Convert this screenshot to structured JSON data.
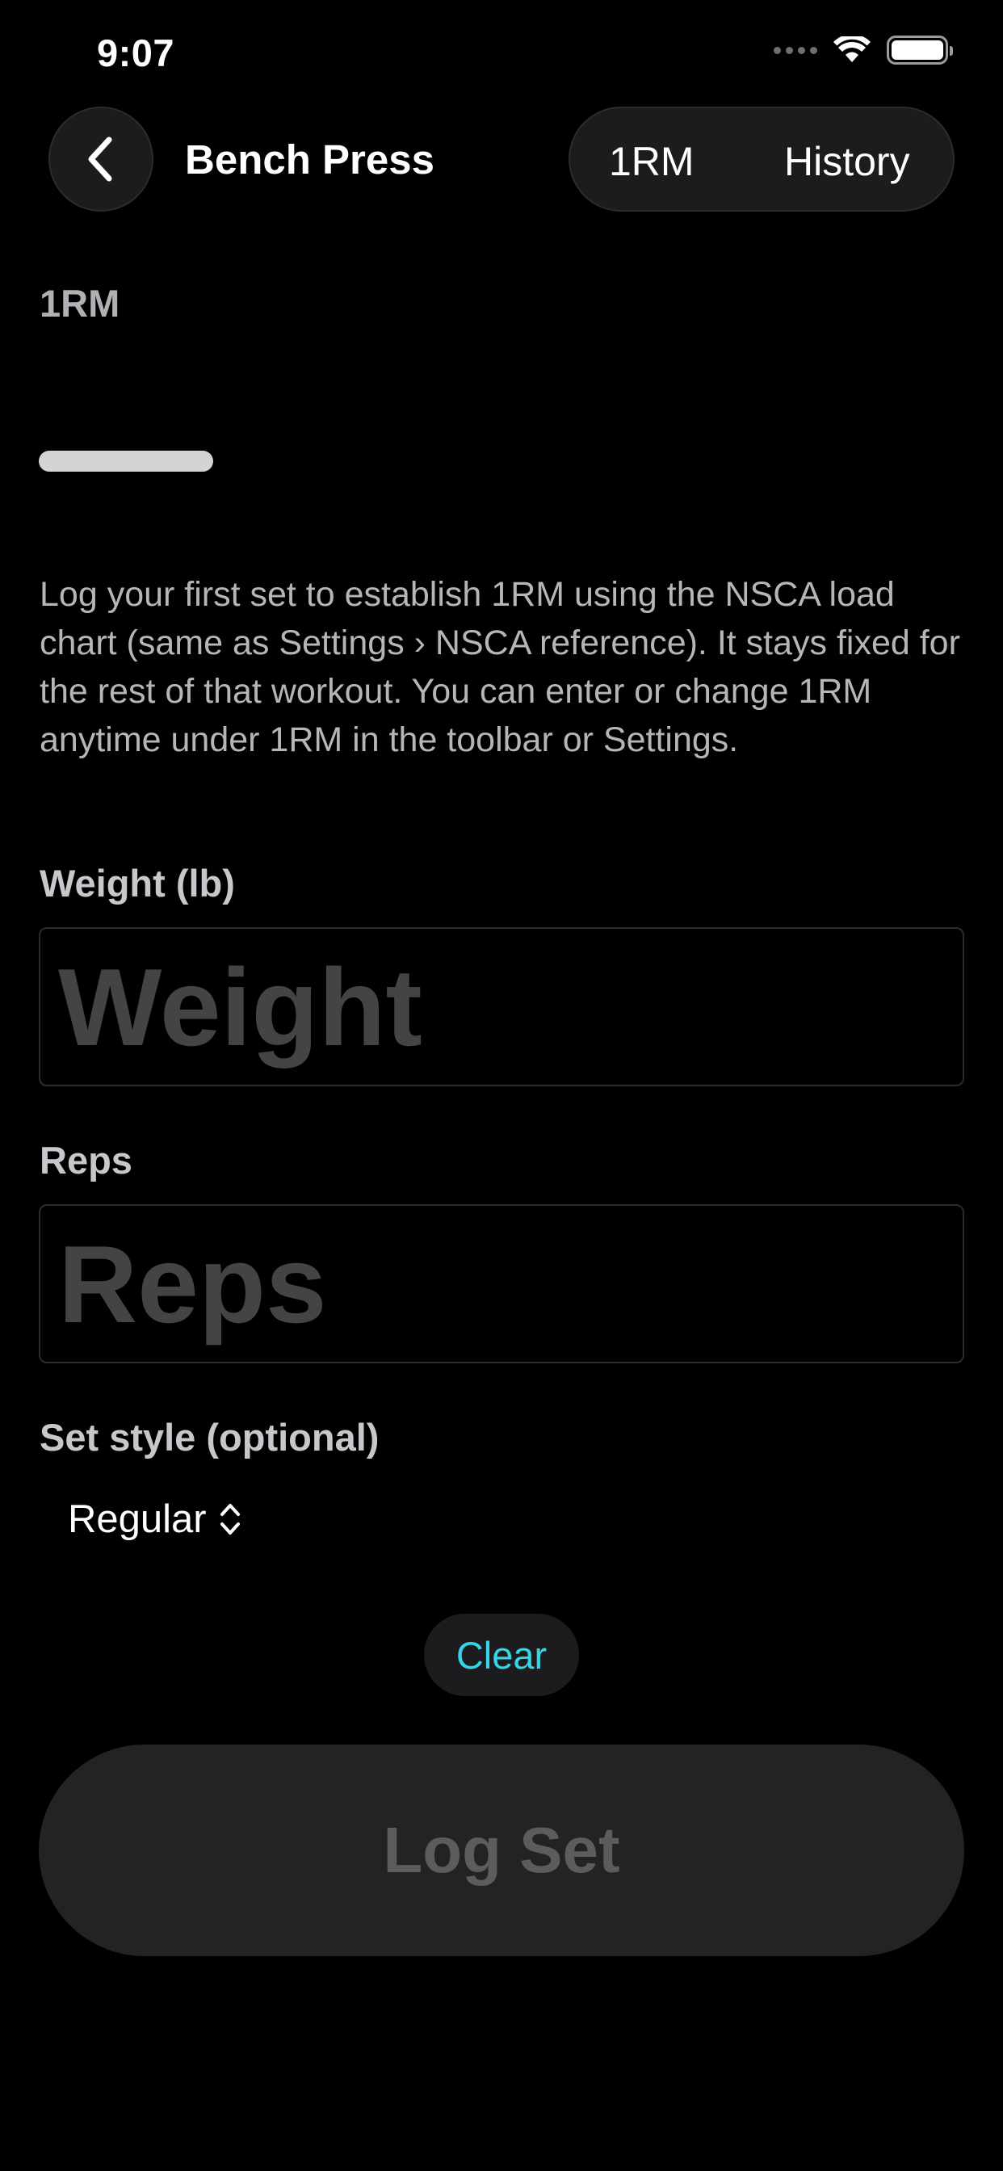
{
  "status_bar": {
    "time": "9:07"
  },
  "nav": {
    "back_icon": "chevron-left-icon",
    "title": "Bench Press",
    "segments": [
      "1RM",
      "History"
    ]
  },
  "one_rm": {
    "label": "1RM",
    "description": "Log your first set to establish 1RM using the NSCA load chart (same as Settings › NSCA reference). It stays fixed for the rest of that workout. You can enter or change 1RM anytime under 1RM in the toolbar or Settings."
  },
  "weight": {
    "label": "Weight (lb)",
    "placeholder": "Weight",
    "value": ""
  },
  "reps": {
    "label": "Reps",
    "placeholder": "Reps",
    "value": ""
  },
  "set_style": {
    "label": "Set style (optional)",
    "selected": "Regular",
    "icon": "chevron-up-down-icon"
  },
  "actions": {
    "clear_label": "Clear",
    "log_set_label": "Log Set"
  },
  "colors": {
    "accent": "#33d6e6",
    "background": "#000000",
    "control_fill": "#1c1c1e",
    "disabled_text": "#5c5c5f"
  }
}
